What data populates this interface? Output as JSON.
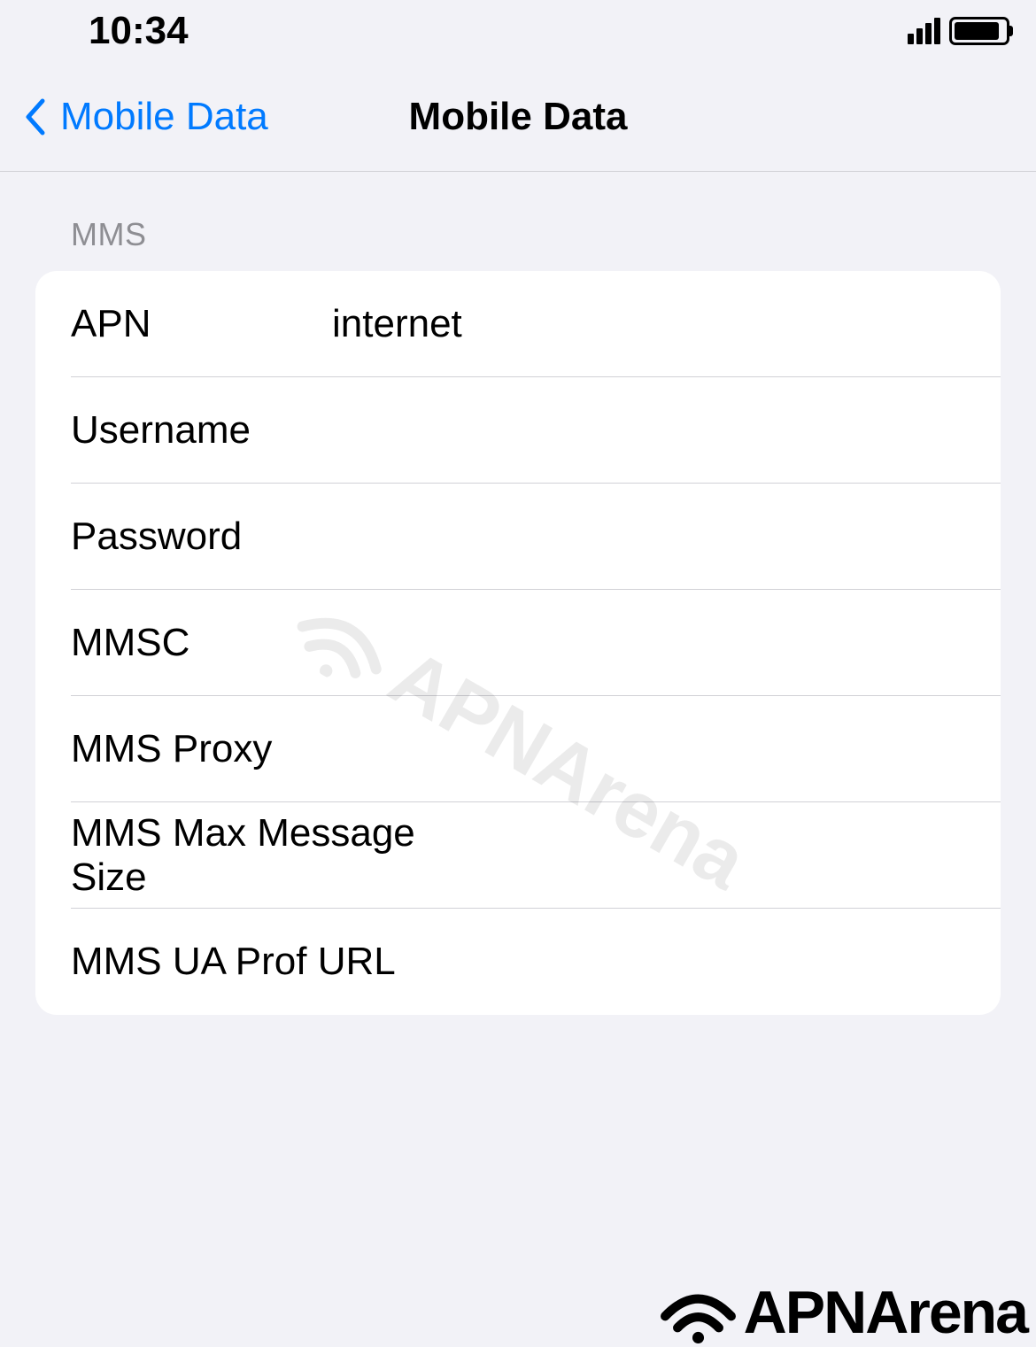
{
  "status": {
    "time": "10:34"
  },
  "nav": {
    "back_label": "Mobile Data",
    "title": "Mobile Data"
  },
  "section": {
    "header": "MMS"
  },
  "fields": {
    "apn": {
      "label": "APN",
      "value": "internet"
    },
    "username": {
      "label": "Username",
      "value": ""
    },
    "password": {
      "label": "Password",
      "value": ""
    },
    "mmsc": {
      "label": "MMSC",
      "value": ""
    },
    "mms_proxy": {
      "label": "MMS Proxy",
      "value": ""
    },
    "mms_max_size": {
      "label": "MMS Max Message Size",
      "value": ""
    },
    "mms_ua_prof": {
      "label": "MMS UA Prof URL",
      "value": ""
    }
  },
  "branding": {
    "watermark": "APNArena",
    "footer": "APNArena"
  }
}
